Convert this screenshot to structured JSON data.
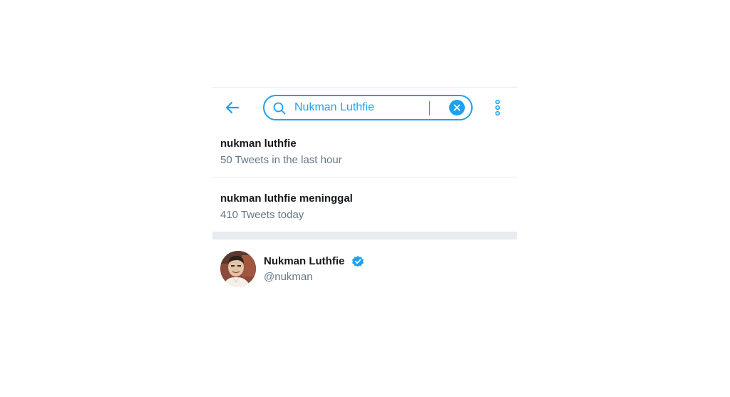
{
  "colors": {
    "accent": "#1da1f2",
    "primary_text": "#14171a",
    "secondary_text": "#657786",
    "divider": "#e6ecf0"
  },
  "header": {
    "back_icon": "arrow-left-icon",
    "search": {
      "icon": "search-icon",
      "value": "Nukman Luthfie",
      "clear_icon": "close-icon"
    },
    "more_icon": "more-vertical-icon"
  },
  "suggestions": [
    {
      "title": "nukman luthfie",
      "subtitle": "50 Tweets in the last hour"
    },
    {
      "title": "nukman luthfie meninggal",
      "subtitle": "410 Tweets today"
    }
  ],
  "user_result": {
    "name": "Nukman Luthfie",
    "handle": "@nukman",
    "verified_icon": "verified-badge-icon"
  }
}
